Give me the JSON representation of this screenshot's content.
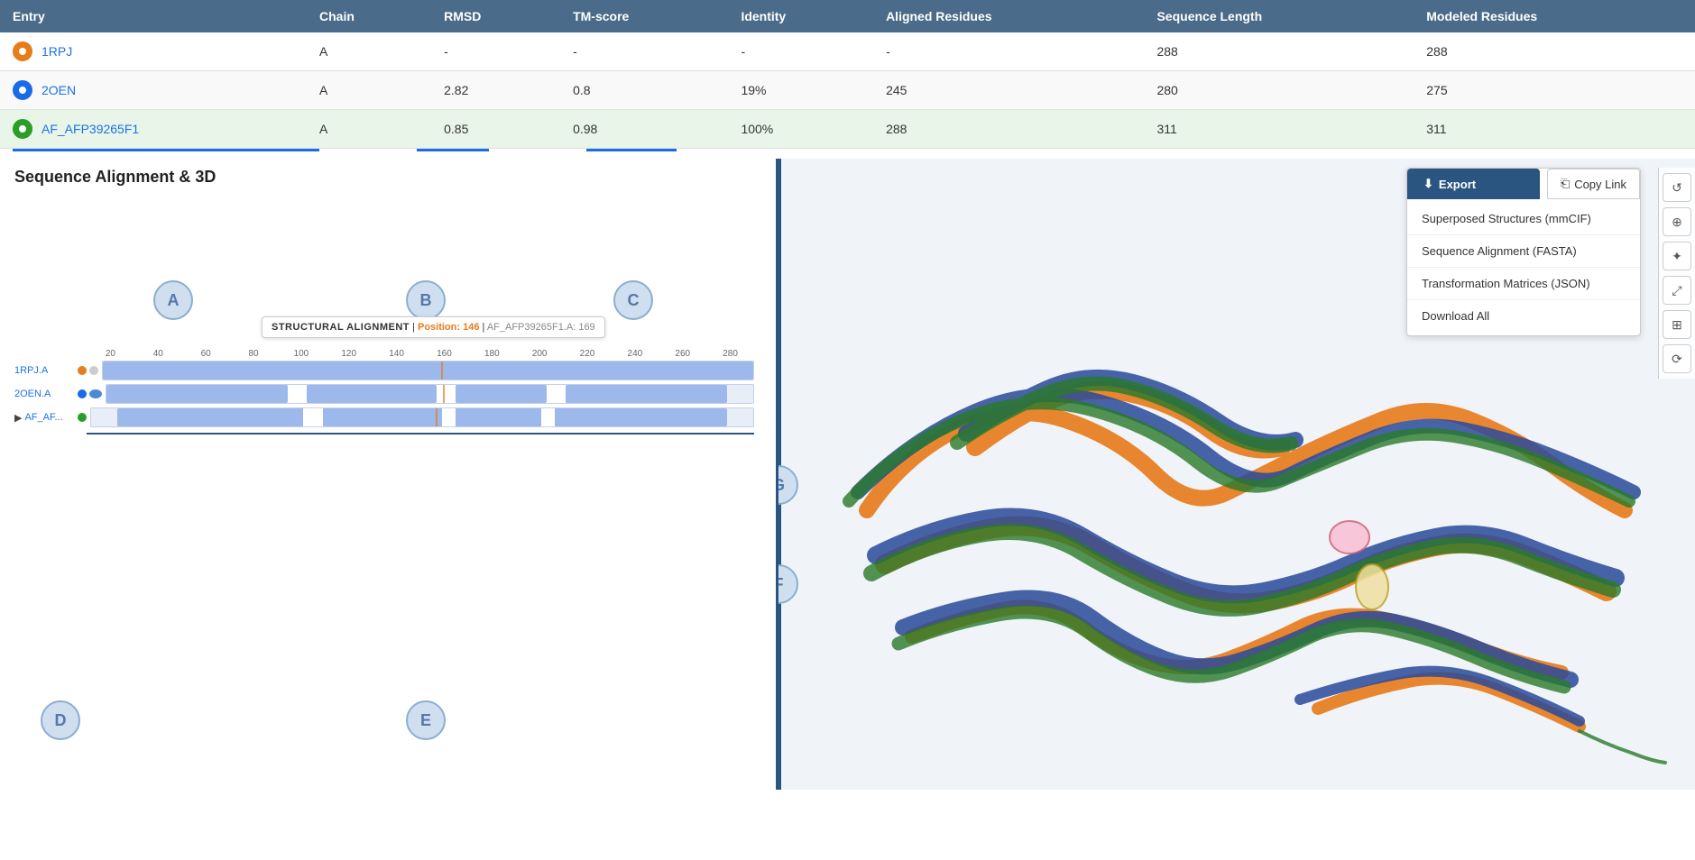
{
  "table": {
    "headers": [
      "Entry",
      "Chain",
      "RMSD",
      "TM-score",
      "Identity",
      "Aligned Residues",
      "Sequence Length",
      "Modeled Residues"
    ],
    "rows": [
      {
        "icon_type": "orange",
        "entry": "1RPJ",
        "chain": "A",
        "rmsd": "-",
        "tm_score": "-",
        "identity": "-",
        "aligned_residues": "-",
        "sequence_length": "288",
        "modeled_residues": "288"
      },
      {
        "icon_type": "blue",
        "entry": "2OEN",
        "chain": "A",
        "rmsd": "2.82",
        "tm_score": "0.8",
        "identity": "19%",
        "aligned_residues": "245",
        "sequence_length": "280",
        "modeled_residues": "275"
      },
      {
        "icon_type": "green",
        "entry": "AF_AFP39265F1",
        "chain": "A",
        "rmsd": "0.85",
        "tm_score": "0.98",
        "identity": "100%",
        "aligned_residues": "288",
        "sequence_length": "311",
        "modeled_residues": "311"
      }
    ]
  },
  "section_title": "Sequence Alignment & 3D",
  "annotations": {
    "A": "A",
    "B": "B",
    "C": "C",
    "D": "D",
    "E": "E",
    "F": "F",
    "G": "G"
  },
  "tooltip": {
    "label": "STRUCTURAL ALIGNMENT",
    "position_label": "Position: 146",
    "entry_ref": "AF_AFP39265F1.A: 169"
  },
  "seq_viewer": {
    "ruler_marks": [
      "20",
      "40",
      "60",
      "80",
      "100",
      "120",
      "140",
      "160",
      "180",
      "200",
      "220",
      "240",
      "260",
      "280"
    ],
    "rows": [
      {
        "label": "1RPJ.A",
        "icon": "orange"
      },
      {
        "label": "2OEN.A",
        "icon": "blue"
      },
      {
        "label": "AF_AF...",
        "icon": "green",
        "has_arrow": true
      }
    ]
  },
  "export_menu": {
    "export_label": "Export",
    "copy_link_label": "Copy Link",
    "items": [
      "Superposed Structures (mmCIF)",
      "Sequence Alignment (FASTA)",
      "Transformation Matrices (JSON)",
      "Download All"
    ]
  },
  "toolbar_icons": [
    {
      "name": "reset-icon",
      "symbol": "↺"
    },
    {
      "name": "center-icon",
      "symbol": "⊕"
    },
    {
      "name": "rotate-icon",
      "symbol": "✦"
    },
    {
      "name": "expand-icon",
      "symbol": "⤢"
    },
    {
      "name": "grid-icon",
      "symbol": "⊞"
    },
    {
      "name": "cursor-icon",
      "symbol": "⤻"
    }
  ]
}
